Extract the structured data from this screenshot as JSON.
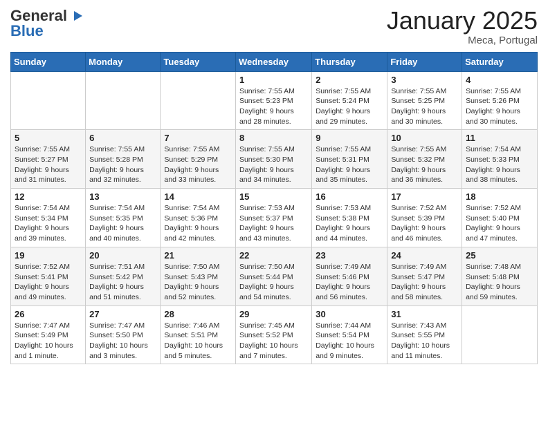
{
  "header": {
    "logo_general": "General",
    "logo_blue": "Blue",
    "month": "January 2025",
    "location": "Meca, Portugal"
  },
  "weekdays": [
    "Sunday",
    "Monday",
    "Tuesday",
    "Wednesday",
    "Thursday",
    "Friday",
    "Saturday"
  ],
  "weeks": [
    [
      {
        "day": "",
        "info": ""
      },
      {
        "day": "",
        "info": ""
      },
      {
        "day": "",
        "info": ""
      },
      {
        "day": "1",
        "info": "Sunrise: 7:55 AM\nSunset: 5:23 PM\nDaylight: 9 hours\nand 28 minutes."
      },
      {
        "day": "2",
        "info": "Sunrise: 7:55 AM\nSunset: 5:24 PM\nDaylight: 9 hours\nand 29 minutes."
      },
      {
        "day": "3",
        "info": "Sunrise: 7:55 AM\nSunset: 5:25 PM\nDaylight: 9 hours\nand 30 minutes."
      },
      {
        "day": "4",
        "info": "Sunrise: 7:55 AM\nSunset: 5:26 PM\nDaylight: 9 hours\nand 30 minutes."
      }
    ],
    [
      {
        "day": "5",
        "info": "Sunrise: 7:55 AM\nSunset: 5:27 PM\nDaylight: 9 hours\nand 31 minutes."
      },
      {
        "day": "6",
        "info": "Sunrise: 7:55 AM\nSunset: 5:28 PM\nDaylight: 9 hours\nand 32 minutes."
      },
      {
        "day": "7",
        "info": "Sunrise: 7:55 AM\nSunset: 5:29 PM\nDaylight: 9 hours\nand 33 minutes."
      },
      {
        "day": "8",
        "info": "Sunrise: 7:55 AM\nSunset: 5:30 PM\nDaylight: 9 hours\nand 34 minutes."
      },
      {
        "day": "9",
        "info": "Sunrise: 7:55 AM\nSunset: 5:31 PM\nDaylight: 9 hours\nand 35 minutes."
      },
      {
        "day": "10",
        "info": "Sunrise: 7:55 AM\nSunset: 5:32 PM\nDaylight: 9 hours\nand 36 minutes."
      },
      {
        "day": "11",
        "info": "Sunrise: 7:54 AM\nSunset: 5:33 PM\nDaylight: 9 hours\nand 38 minutes."
      }
    ],
    [
      {
        "day": "12",
        "info": "Sunrise: 7:54 AM\nSunset: 5:34 PM\nDaylight: 9 hours\nand 39 minutes."
      },
      {
        "day": "13",
        "info": "Sunrise: 7:54 AM\nSunset: 5:35 PM\nDaylight: 9 hours\nand 40 minutes."
      },
      {
        "day": "14",
        "info": "Sunrise: 7:54 AM\nSunset: 5:36 PM\nDaylight: 9 hours\nand 42 minutes."
      },
      {
        "day": "15",
        "info": "Sunrise: 7:53 AM\nSunset: 5:37 PM\nDaylight: 9 hours\nand 43 minutes."
      },
      {
        "day": "16",
        "info": "Sunrise: 7:53 AM\nSunset: 5:38 PM\nDaylight: 9 hours\nand 44 minutes."
      },
      {
        "day": "17",
        "info": "Sunrise: 7:52 AM\nSunset: 5:39 PM\nDaylight: 9 hours\nand 46 minutes."
      },
      {
        "day": "18",
        "info": "Sunrise: 7:52 AM\nSunset: 5:40 PM\nDaylight: 9 hours\nand 47 minutes."
      }
    ],
    [
      {
        "day": "19",
        "info": "Sunrise: 7:52 AM\nSunset: 5:41 PM\nDaylight: 9 hours\nand 49 minutes."
      },
      {
        "day": "20",
        "info": "Sunrise: 7:51 AM\nSunset: 5:42 PM\nDaylight: 9 hours\nand 51 minutes."
      },
      {
        "day": "21",
        "info": "Sunrise: 7:50 AM\nSunset: 5:43 PM\nDaylight: 9 hours\nand 52 minutes."
      },
      {
        "day": "22",
        "info": "Sunrise: 7:50 AM\nSunset: 5:44 PM\nDaylight: 9 hours\nand 54 minutes."
      },
      {
        "day": "23",
        "info": "Sunrise: 7:49 AM\nSunset: 5:46 PM\nDaylight: 9 hours\nand 56 minutes."
      },
      {
        "day": "24",
        "info": "Sunrise: 7:49 AM\nSunset: 5:47 PM\nDaylight: 9 hours\nand 58 minutes."
      },
      {
        "day": "25",
        "info": "Sunrise: 7:48 AM\nSunset: 5:48 PM\nDaylight: 9 hours\nand 59 minutes."
      }
    ],
    [
      {
        "day": "26",
        "info": "Sunrise: 7:47 AM\nSunset: 5:49 PM\nDaylight: 10 hours\nand 1 minute."
      },
      {
        "day": "27",
        "info": "Sunrise: 7:47 AM\nSunset: 5:50 PM\nDaylight: 10 hours\nand 3 minutes."
      },
      {
        "day": "28",
        "info": "Sunrise: 7:46 AM\nSunset: 5:51 PM\nDaylight: 10 hours\nand 5 minutes."
      },
      {
        "day": "29",
        "info": "Sunrise: 7:45 AM\nSunset: 5:52 PM\nDaylight: 10 hours\nand 7 minutes."
      },
      {
        "day": "30",
        "info": "Sunrise: 7:44 AM\nSunset: 5:54 PM\nDaylight: 10 hours\nand 9 minutes."
      },
      {
        "day": "31",
        "info": "Sunrise: 7:43 AM\nSunset: 5:55 PM\nDaylight: 10 hours\nand 11 minutes."
      },
      {
        "day": "",
        "info": ""
      }
    ]
  ]
}
